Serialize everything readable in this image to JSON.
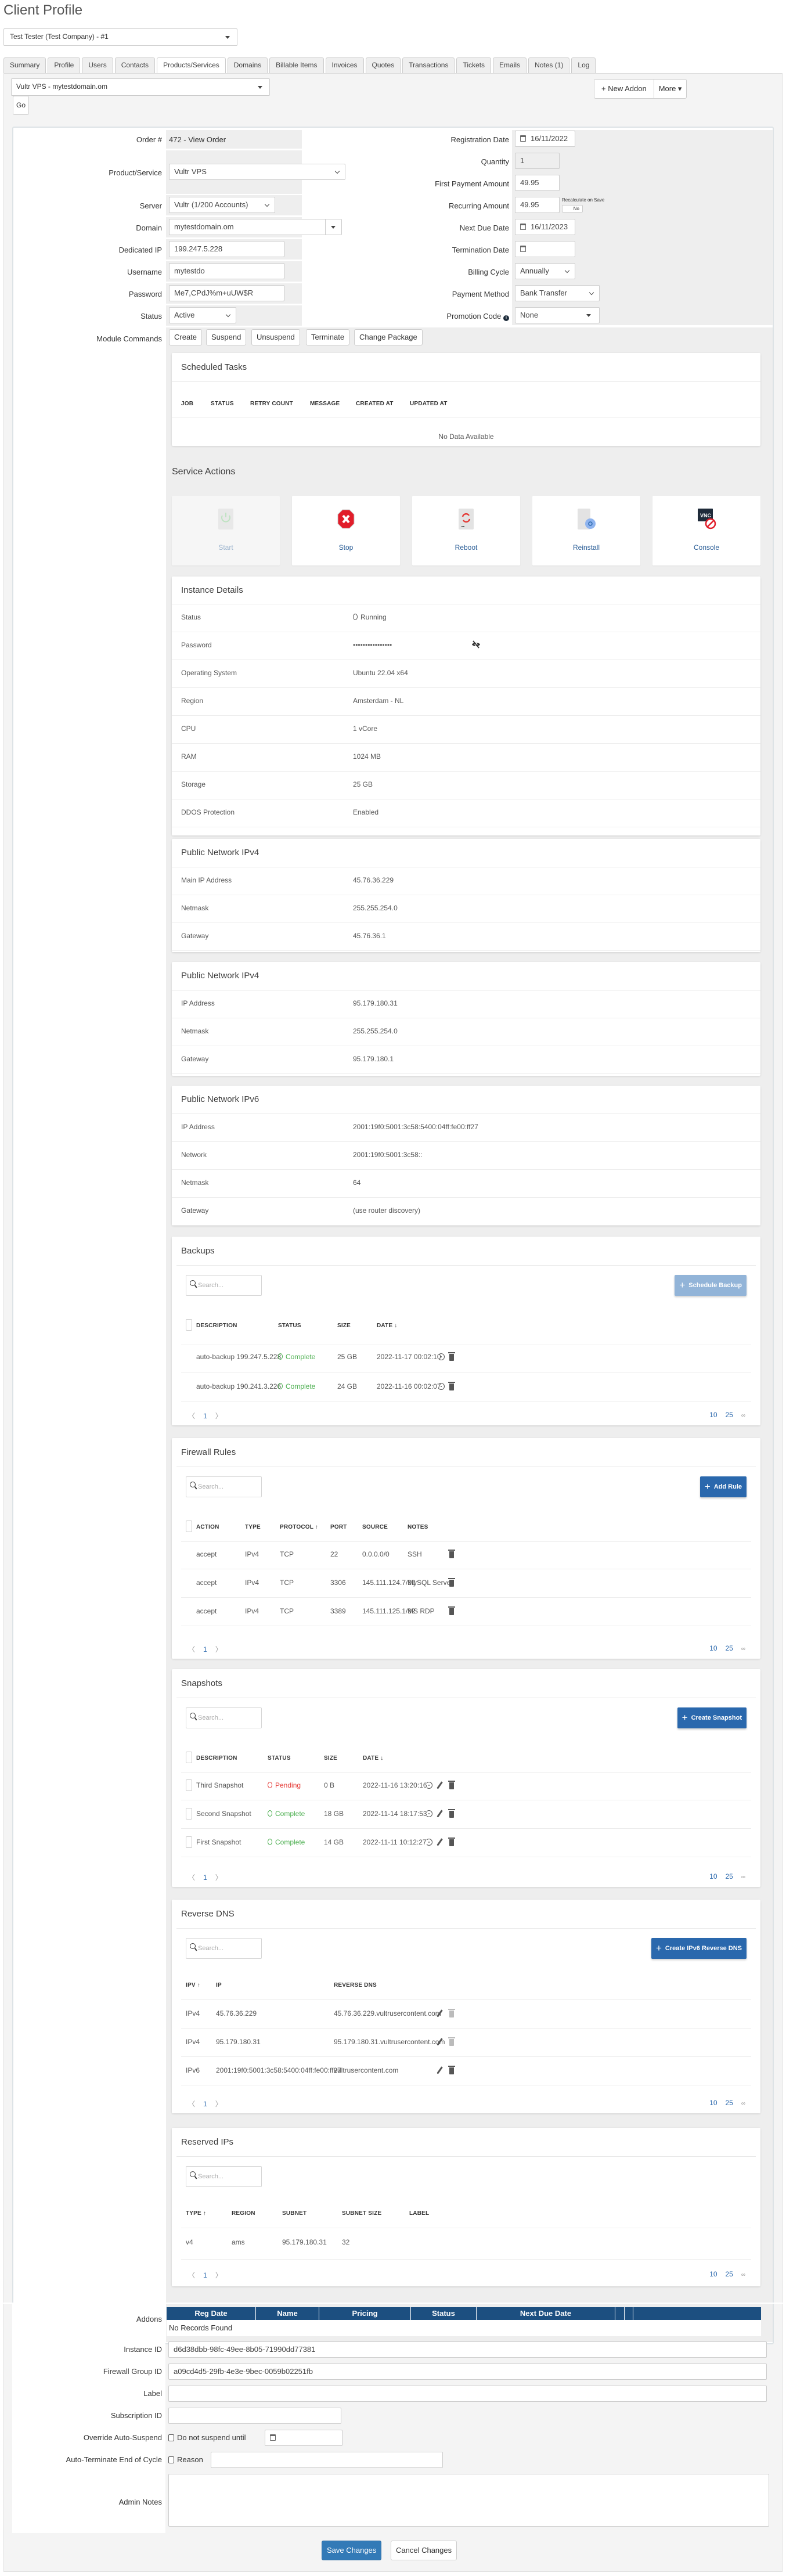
{
  "page": {
    "title": "Client Profile"
  },
  "client_selector": {
    "value": "Test Tester (Test Company) - #1"
  },
  "tabs": [
    {
      "label": "Summary",
      "active": false
    },
    {
      "label": "Profile",
      "active": false
    },
    {
      "label": "Users",
      "active": false
    },
    {
      "label": "Contacts",
      "active": false
    },
    {
      "label": "Products/Services",
      "active": true
    },
    {
      "label": "Domains",
      "active": false
    },
    {
      "label": "Billable Items",
      "active": false
    },
    {
      "label": "Invoices",
      "active": false
    },
    {
      "label": "Quotes",
      "active": false
    },
    {
      "label": "Transactions",
      "active": false
    },
    {
      "label": "Tickets",
      "active": false
    },
    {
      "label": "Emails",
      "active": false
    },
    {
      "label": "Notes (1)",
      "active": false
    },
    {
      "label": "Log",
      "active": false
    }
  ],
  "service_selector": {
    "value": "Vultr VPS - mytestdomain.om",
    "go_label": "Go"
  },
  "toolbar": {
    "new_addon_label": "+ New Addon",
    "more_label": "More ▾"
  },
  "form_left": {
    "order": {
      "label": "Order #",
      "value": "472 - View Order"
    },
    "product": {
      "label": "Product/Service",
      "value": "Vultr VPS"
    },
    "server": {
      "label": "Server",
      "value": "Vultr (1/200 Accounts)"
    },
    "domain": {
      "label": "Domain",
      "value": "mytestdomain.om"
    },
    "dedicated_ip": {
      "label": "Dedicated IP",
      "value": "199.247.5.228"
    },
    "username": {
      "label": "Username",
      "value": "mytestdo"
    },
    "password": {
      "label": "Password",
      "value": "Me7,CPdJ%m+uUW$R"
    },
    "status": {
      "label": "Status",
      "value": "Active"
    },
    "module_commands": {
      "label": "Module Commands",
      "buttons": [
        "Create",
        "Suspend",
        "Unsuspend",
        "Terminate",
        "Change Package"
      ]
    }
  },
  "form_right": {
    "registration_date": {
      "label": "Registration Date",
      "value": "16/11/2022"
    },
    "quantity": {
      "label": "Quantity",
      "value": "1"
    },
    "first_payment": {
      "label": "First Payment Amount",
      "value": "49.95"
    },
    "recurring": {
      "label": "Recurring Amount",
      "value": "49.95",
      "recalc_label": "Recalculate on Save",
      "recalc_toggle": "No"
    },
    "next_due": {
      "label": "Next Due Date",
      "value": "16/11/2023"
    },
    "termination": {
      "label": "Termination Date",
      "value": ""
    },
    "billing_cycle": {
      "label": "Billing Cycle",
      "value": "Annually"
    },
    "payment_method": {
      "label": "Payment Method",
      "value": "Bank Transfer"
    },
    "promotion_code": {
      "label": "Promotion Code",
      "value": "None"
    }
  },
  "scheduled_tasks": {
    "title": "Scheduled Tasks",
    "columns": [
      "JOB",
      "STATUS",
      "RETRY COUNT",
      "MESSAGE",
      "CREATED AT",
      "UPDATED AT"
    ],
    "empty": "No Data Available"
  },
  "service_actions": {
    "title": "Service Actions",
    "items": [
      {
        "label": "Start",
        "icon": "power-icon",
        "disabled": true
      },
      {
        "label": "Stop",
        "icon": "stop-icon",
        "disabled": false
      },
      {
        "label": "Reboot",
        "icon": "reboot-icon",
        "disabled": false
      },
      {
        "label": "Reinstall",
        "icon": "reinstall-icon",
        "disabled": false
      },
      {
        "label": "Console",
        "icon": "vnc-console-icon",
        "disabled": false
      }
    ]
  },
  "instance_details": {
    "title": "Instance Details",
    "rows": [
      {
        "key": "Status",
        "value": "Running"
      },
      {
        "key": "Password",
        "value": "••••••••••••••••"
      },
      {
        "key": "Operating System",
        "value": "Ubuntu 22.04 x64"
      },
      {
        "key": "Region",
        "value": "Amsterdam - NL"
      },
      {
        "key": "CPU",
        "value": "1 vCore"
      },
      {
        "key": "RAM",
        "value": "1024 MB"
      },
      {
        "key": "Storage",
        "value": "25 GB"
      },
      {
        "key": "DDOS Protection",
        "value": "Enabled"
      }
    ]
  },
  "ipv4_main": {
    "title": "Public Network IPv4",
    "rows": [
      {
        "key": "Main IP Address",
        "value": "45.76.36.229"
      },
      {
        "key": "Netmask",
        "value": "255.255.254.0"
      },
      {
        "key": "Gateway",
        "value": "45.76.36.1"
      }
    ]
  },
  "ipv4_extra": {
    "title": "Public Network IPv4",
    "rows": [
      {
        "key": "IP Address",
        "value": "95.179.180.31"
      },
      {
        "key": "Netmask",
        "value": "255.255.254.0"
      },
      {
        "key": "Gateway",
        "value": "95.179.180.1"
      }
    ]
  },
  "ipv6": {
    "title": "Public Network IPv6",
    "rows": [
      {
        "key": "IP Address",
        "value": "2001:19f0:5001:3c58:5400:04ff:fe00:ff27"
      },
      {
        "key": "Network",
        "value": "2001:19f0:5001:3c58::"
      },
      {
        "key": "Netmask",
        "value": "64"
      },
      {
        "key": "Gateway",
        "value": "(use router discovery)"
      }
    ]
  },
  "search_placeholder": "Search...",
  "pagination": {
    "page": "1",
    "sizes": [
      "10",
      "25",
      "∞"
    ]
  },
  "backups": {
    "title": "Backups",
    "button": "Schedule Backup",
    "columns": [
      "DESCRIPTION",
      "STATUS",
      "SIZE",
      "DATE ↓"
    ],
    "rows": [
      {
        "description": "auto-backup 199.247.5.228",
        "status": "Complete",
        "size": "25 GB",
        "date": "2022-11-17 00:02:10"
      },
      {
        "description": "auto-backup 190.241.3.226",
        "status": "Complete",
        "size": "24 GB",
        "date": "2022-11-16 00:02:07"
      }
    ]
  },
  "firewall": {
    "title": "Firewall Rules",
    "button": "Add Rule",
    "columns": [
      "ACTION",
      "TYPE",
      "PROTOCOL ↑",
      "PORT",
      "SOURCE",
      "NOTES"
    ],
    "rows": [
      {
        "action": "accept",
        "type": "IPv4",
        "protocol": "TCP",
        "port": "22",
        "source": "0.0.0.0/0",
        "notes": "SSH"
      },
      {
        "action": "accept",
        "type": "IPv4",
        "protocol": "TCP",
        "port": "3306",
        "source": "145.111.124.7/32",
        "notes": "MySQL Server"
      },
      {
        "action": "accept",
        "type": "IPv4",
        "protocol": "TCP",
        "port": "3389",
        "source": "145.111.125.1/32",
        "notes": "MS RDP"
      }
    ]
  },
  "snapshots": {
    "title": "Snapshots",
    "button": "Create Snapshot",
    "columns": [
      "DESCRIPTION",
      "STATUS",
      "SIZE",
      "DATE ↓"
    ],
    "rows": [
      {
        "description": "Third Snapshot",
        "status": "Pending",
        "size": "0 B",
        "date": "2022-11-16 13:20:16"
      },
      {
        "description": "Second Snapshot",
        "status": "Complete",
        "size": "18 GB",
        "date": "2022-11-14 18:17:53"
      },
      {
        "description": "First Snapshot",
        "status": "Complete",
        "size": "14 GB",
        "date": "2022-11-11 10:12:27"
      }
    ]
  },
  "reverse_dns": {
    "title": "Reverse DNS",
    "button": "Create IPv6 Reverse DNS",
    "columns": [
      "IPV ↑",
      "IP",
      "REVERSE DNS"
    ],
    "rows": [
      {
        "ipv": "IPv4",
        "ip": "45.76.36.229",
        "rdns": "45.76.36.229.vultrusercontent.com"
      },
      {
        "ipv": "IPv4",
        "ip": "95.179.180.31",
        "rdns": "95.179.180.31.vultrusercontent.com"
      },
      {
        "ipv": "IPv6",
        "ip": "2001:19f0:5001:3c58:5400:04ff:fe00:ff27",
        "rdns": "vultrusercontent.com"
      }
    ]
  },
  "reserved_ips": {
    "title": "Reserved IPs",
    "columns": [
      "TYPE ↑",
      "REGION",
      "SUBNET",
      "SUBNET SIZE",
      "LABEL"
    ],
    "rows": [
      {
        "type": "v4",
        "region": "ams",
        "subnet": "95.179.180.31",
        "subnet_size": "32",
        "label": ""
      }
    ]
  },
  "addons": {
    "label": "Addons",
    "columns": [
      "Reg Date",
      "Name",
      "Pricing",
      "Status",
      "Next Due Date",
      "",
      ""
    ],
    "empty": "No Records Found"
  },
  "bottom_fields": {
    "instance_id": {
      "label": "Instance ID",
      "value": "d6d38dbb-98fc-49ee-8b05-71990dd77381"
    },
    "firewall_group_id": {
      "label": "Firewall Group ID",
      "value": "a09cd4d5-29fb-4e3e-9bec-0059b02251fb"
    },
    "label": {
      "label": "Label",
      "value": ""
    },
    "subscription_id": {
      "label": "Subscription ID",
      "value": ""
    },
    "override_auto_suspend": {
      "label": "Override Auto-Suspend",
      "checkbox_label": "Do not suspend until"
    },
    "auto_terminate": {
      "label": "Auto-Terminate End of Cycle",
      "checkbox_label": "Reason"
    },
    "admin_notes": {
      "label": "Admin Notes",
      "value": ""
    }
  },
  "footer": {
    "save": "Save Changes",
    "cancel": "Cancel Changes"
  },
  "colors": {
    "primary": "#2a68ad",
    "header": "#1c4f80",
    "success": "#4caf50",
    "danger": "#e53935"
  }
}
